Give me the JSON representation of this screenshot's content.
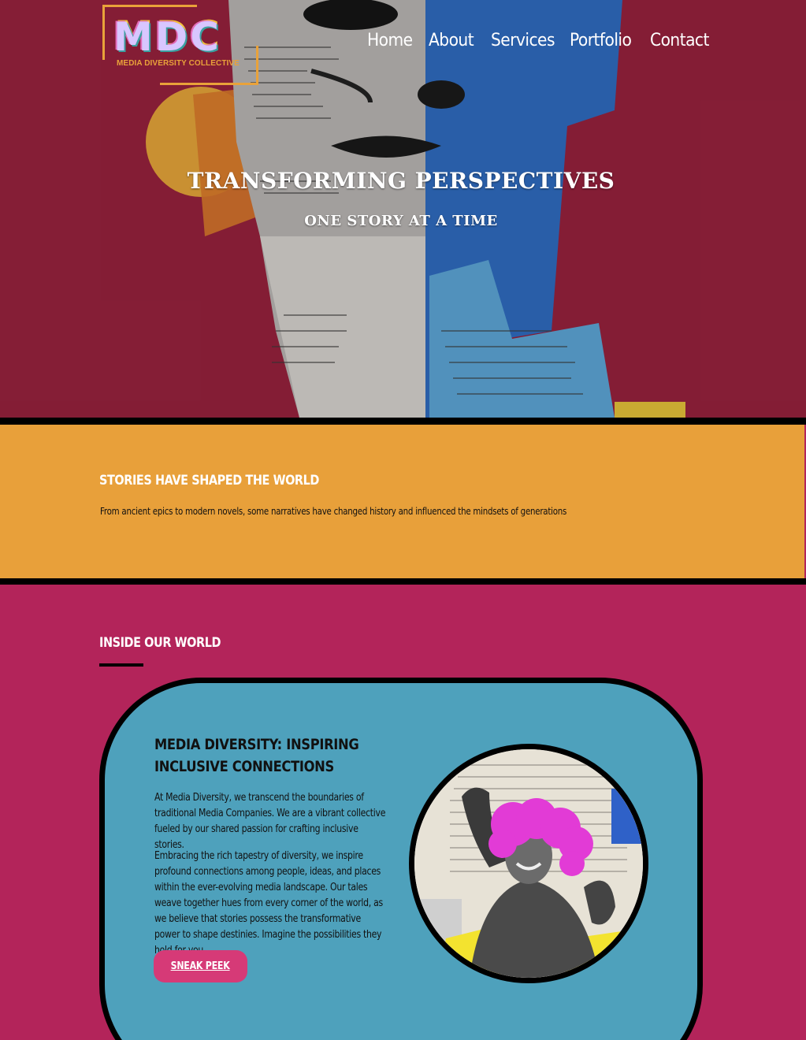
{
  "logo": {
    "mark": "MDC",
    "subtitle": "MEDIA DIVERSITY COLLECTIVE"
  },
  "nav": {
    "items": [
      "Home",
      "About",
      "Services",
      "Portfolio",
      "Contact"
    ]
  },
  "hero": {
    "title": "TRANSFORMING PERSPECTIVES",
    "subtitle": "ONE STORY AT A TIME"
  },
  "stories": {
    "title": "STORIES HAVE SHAPED THE WORLD",
    "text": "From ancient epics to modern novels, some narratives have changed history and influenced the mindsets of generations"
  },
  "inside": {
    "title": "INSIDE OUR WORLD",
    "card": {
      "title": "MEDIA DIVERSITY: INSPIRING INCLUSIVE CONNECTIONS",
      "paragraph1": "At Media Diversity, we transcend the boundaries of traditional Media Companies. We are a vibrant collective fueled by our shared passion for crafting inclusive stories.",
      "paragraph2": "Embracing the rich tapestry of diversity, we inspire profound connections among people, ideas, and places within the ever-evolving media landscape. Our tales weave together hues from every corner of the world, as we believe that stories possess the transformative power to shape destinies. Imagine the possibilities they hold for you.",
      "button": "SNEAK PEEK"
    }
  },
  "colors": {
    "hero_bg": "#96213c",
    "accent_orange": "#e8a03a",
    "section_magenta": "#b3245a",
    "card_blue": "#4ea1bc",
    "button_pink": "#d63a77"
  }
}
